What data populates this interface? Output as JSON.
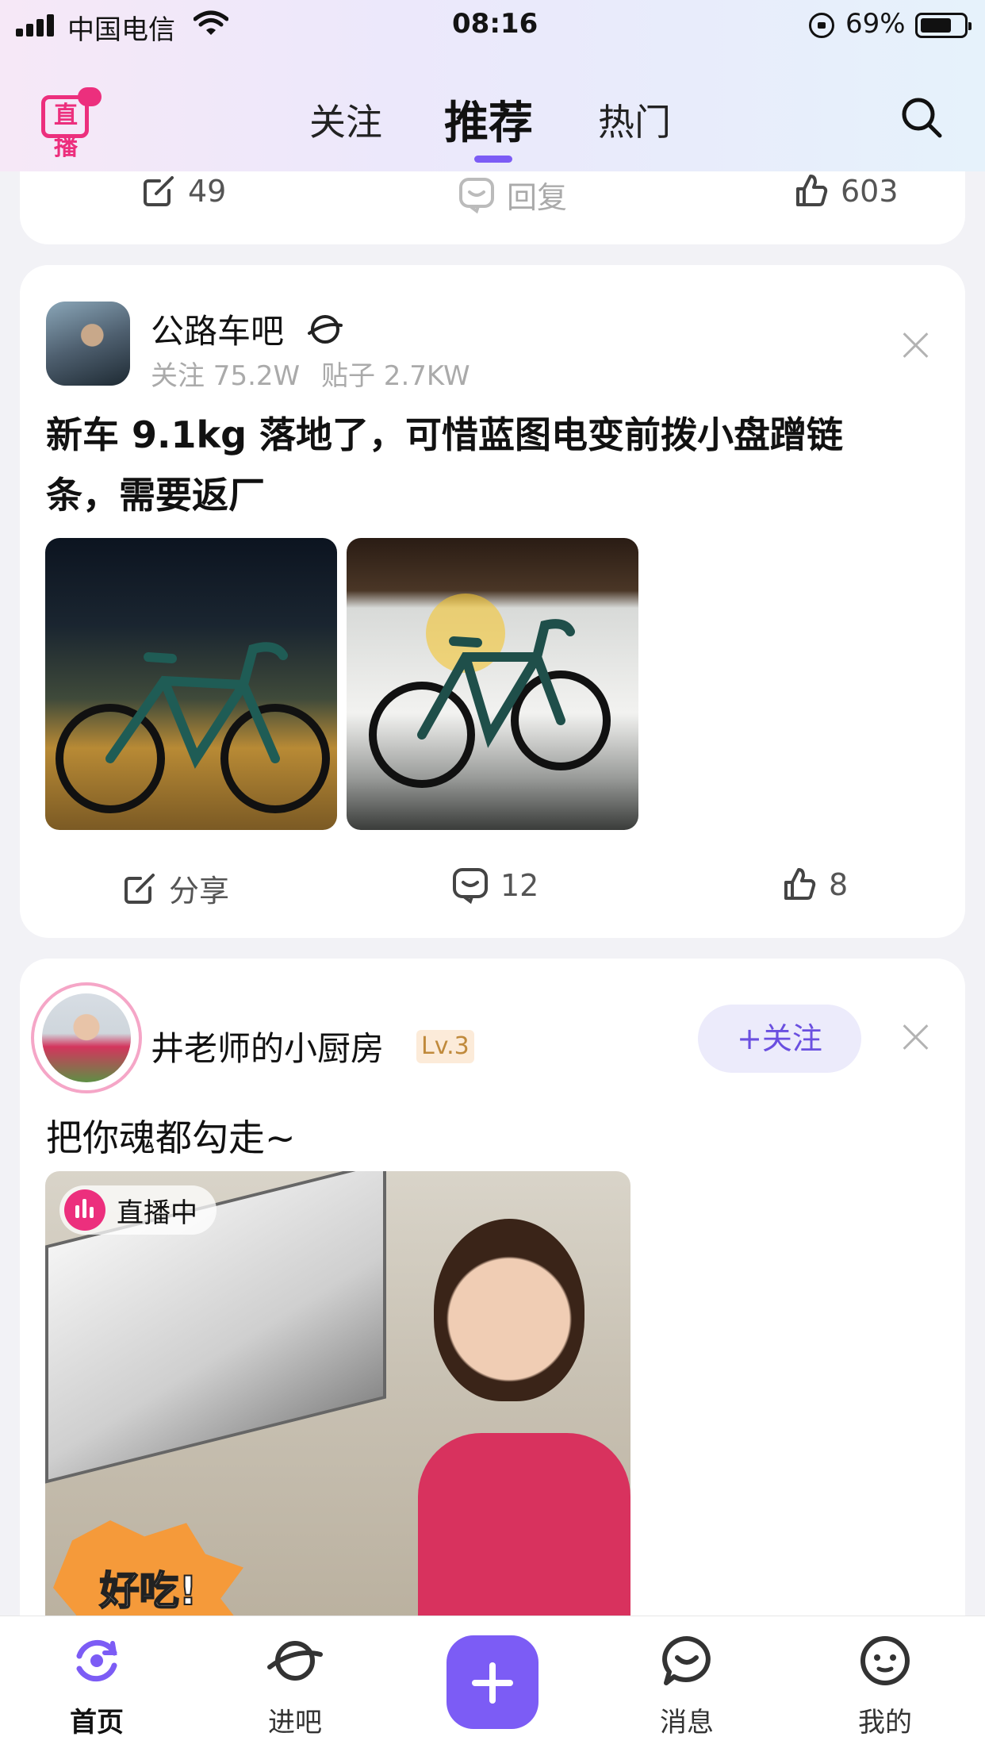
{
  "status_bar": {
    "carrier": "中国电信",
    "time": "08:16",
    "battery": "69%"
  },
  "header": {
    "logo_text": "直播",
    "tabs": [
      {
        "label": "关注",
        "active": false
      },
      {
        "label": "推荐",
        "active": true
      },
      {
        "label": "热门",
        "active": false
      }
    ],
    "accent": "#7c5cf5"
  },
  "prev_card": {
    "share_count": "49",
    "reply_label": "回复",
    "like_count": "603"
  },
  "post1": {
    "forum_name": "公路车吧",
    "followers": "关注 75.2W",
    "posts": "贴子 2.7KW",
    "title_line1": "新车 9.1kg 落地了，可惜蓝图电变前拨小盘蹭链",
    "title_line2": "条，需要返厂",
    "share_label": "分享",
    "comment_count": "12",
    "like_count": "8"
  },
  "post2": {
    "user_name": "井老师的小厨房",
    "level": "Lv.3",
    "follow_label": "+关注",
    "text": "把你魂都勾走~",
    "live_label": "直播中",
    "live_color": "#ec2f7d",
    "sticker_text": "好吃!"
  },
  "bottom_nav": [
    {
      "label": "首页",
      "icon": "home-icon",
      "active": true
    },
    {
      "label": "进吧",
      "icon": "planet-icon",
      "active": false
    },
    {
      "label": "",
      "icon": "plus-icon",
      "active": false
    },
    {
      "label": "消息",
      "icon": "message-icon",
      "active": false
    },
    {
      "label": "我的",
      "icon": "profile-icon",
      "active": false
    }
  ]
}
